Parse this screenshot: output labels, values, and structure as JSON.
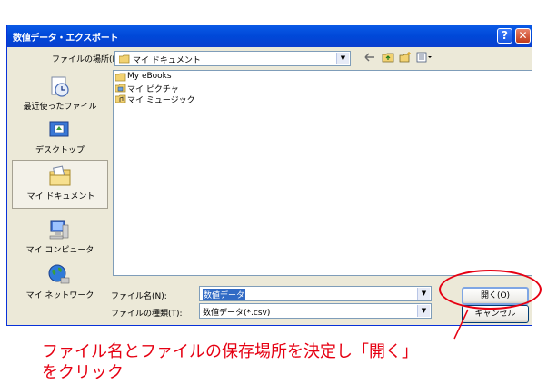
{
  "window": {
    "title": "数値データ・エクスポート",
    "help_label": "?",
    "close_label": "✕"
  },
  "look_in": {
    "label": "ファイルの場所(I):",
    "value": "マイ ドキュメント",
    "toolbar_icons": [
      "back-arrow-icon",
      "up-folder-icon",
      "new-folder-icon",
      "view-menu-icon"
    ]
  },
  "places": [
    {
      "label": "最近使ったファイル",
      "icon": "recent-files-icon"
    },
    {
      "label": "デスクトップ",
      "icon": "desktop-icon"
    },
    {
      "label": "マイ ドキュメント",
      "icon": "my-documents-icon",
      "selected": true
    },
    {
      "label": "マイ コンピュータ",
      "icon": "my-computer-icon"
    },
    {
      "label": "マイ ネットワーク",
      "icon": "my-network-icon"
    }
  ],
  "files": [
    {
      "name": "My eBooks",
      "icon": "folder-icon"
    },
    {
      "name": "マイ ピクチャ",
      "icon": "pictures-folder-icon"
    },
    {
      "name": "マイ ミュージック",
      "icon": "music-folder-icon"
    }
  ],
  "file_name": {
    "label": "ファイル名(N):",
    "value": "数値データ"
  },
  "file_type": {
    "label": "ファイルの種類(T):",
    "value": "数値データ(*.csv)"
  },
  "buttons": {
    "open": "開く(O)",
    "cancel": "キャンセル"
  },
  "annotation": {
    "line1": "ファイル名とファイルの保存場所を決定し「開く」",
    "line2": "をクリック",
    "color": "#e60012"
  }
}
